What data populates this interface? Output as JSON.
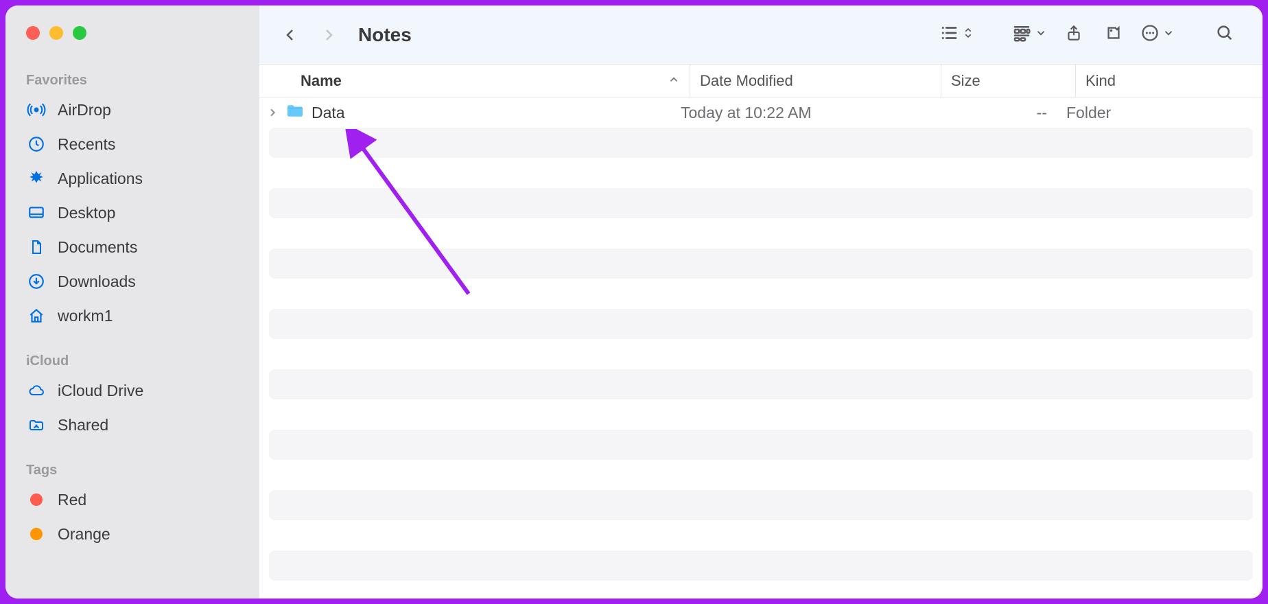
{
  "window": {
    "title": "Notes"
  },
  "sidebar": {
    "sections": {
      "favorites": {
        "label": "Favorites",
        "items": {
          "airdrop": "AirDrop",
          "recents": "Recents",
          "applications": "Applications",
          "desktop": "Desktop",
          "documents": "Documents",
          "downloads": "Downloads",
          "home": "workm1"
        }
      },
      "icloud": {
        "label": "iCloud",
        "items": {
          "drive": "iCloud Drive",
          "shared": "Shared"
        }
      },
      "tags": {
        "label": "Tags",
        "items": {
          "red": {
            "label": "Red",
            "color": "#ff5b4f"
          },
          "orange": {
            "label": "Orange",
            "color": "#ff9500"
          }
        }
      }
    }
  },
  "columns": {
    "name": "Name",
    "date_modified": "Date Modified",
    "size": "Size",
    "kind": "Kind"
  },
  "rows": [
    {
      "name": "Data",
      "date_modified": "Today at 10:22 AM",
      "size": "--",
      "kind": "Folder"
    }
  ]
}
